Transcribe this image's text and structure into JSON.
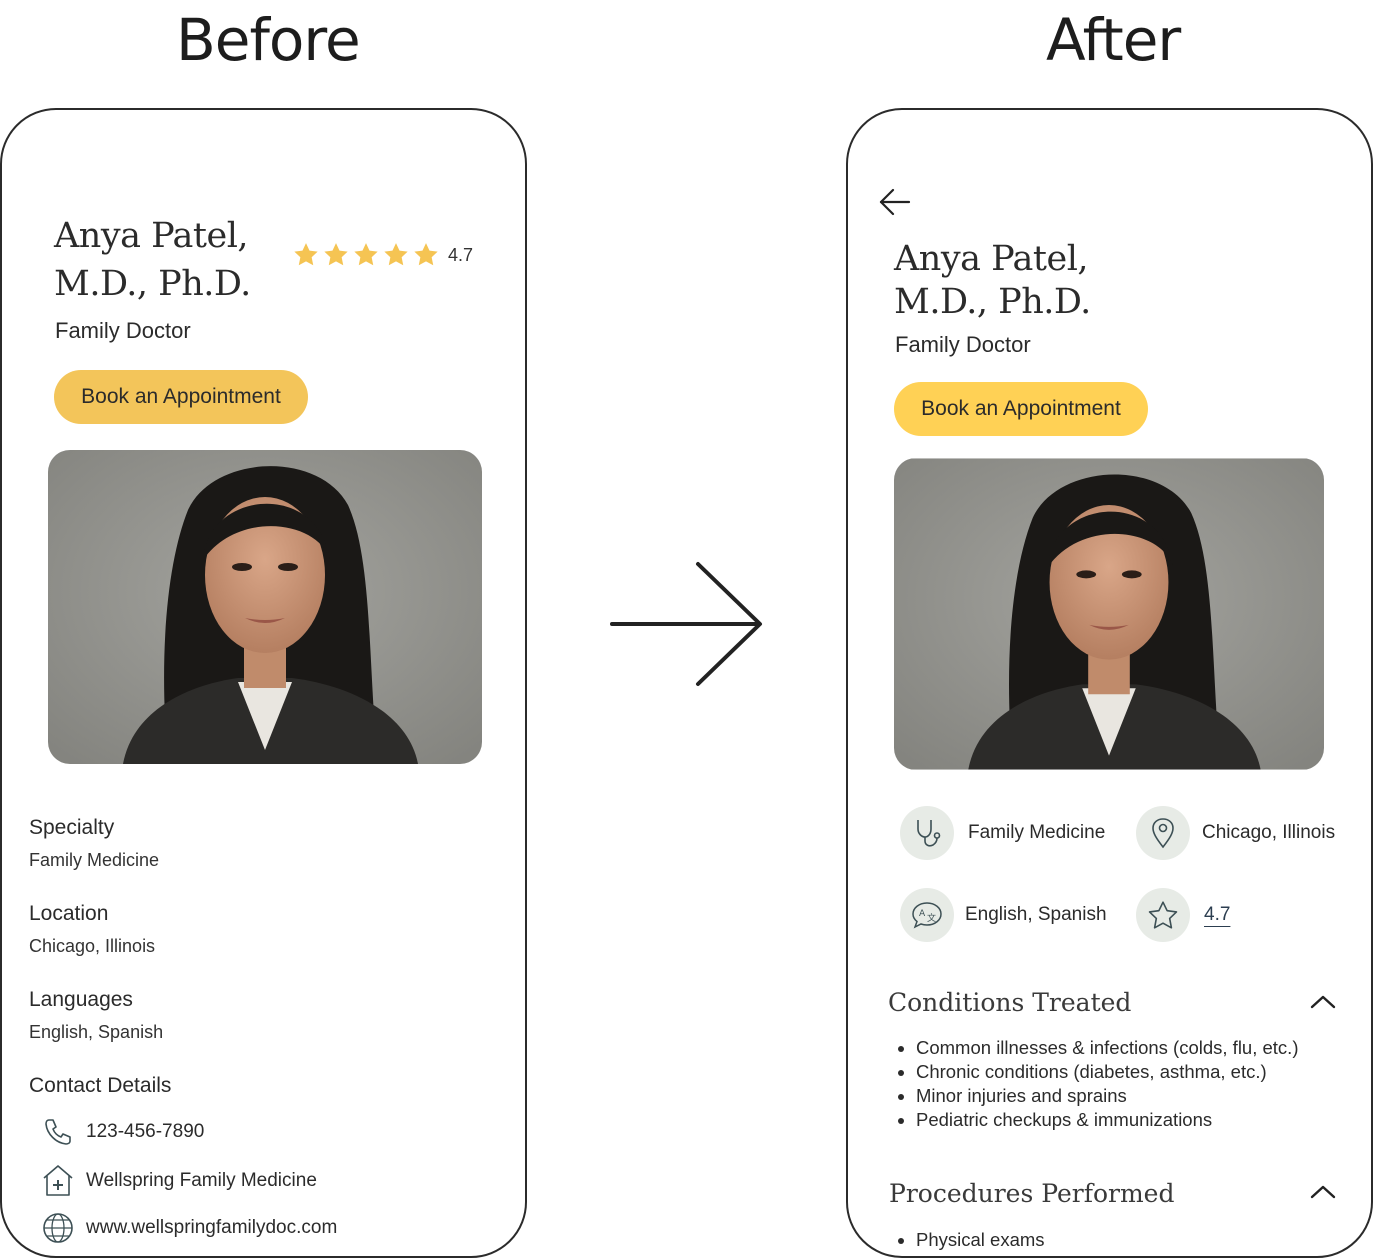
{
  "headings": {
    "before": "Before",
    "after": "After"
  },
  "profile": {
    "name_line1": "Anya Patel,",
    "name_line2": "M.D., Ph.D.",
    "title": "Family Doctor",
    "book_label": "Book an Appointment",
    "rating": "4.7",
    "rating_value": 4.7,
    "stars_total": 5
  },
  "before": {
    "details": [
      {
        "label": "Specialty",
        "value": "Family Medicine"
      },
      {
        "label": "Location",
        "value": "Chicago, Illinois"
      },
      {
        "label": "Languages",
        "value": "English, Spanish"
      }
    ],
    "contact_heading": "Contact Details",
    "contacts": [
      {
        "icon": "phone-icon",
        "text": "123-456-7890"
      },
      {
        "icon": "clinic-icon",
        "text": "Wellspring Family Medicine"
      },
      {
        "icon": "globe-www-icon",
        "text": "www.wellspringfamilydoc.com"
      }
    ]
  },
  "after": {
    "info": [
      {
        "icon": "stethoscope-icon",
        "text": "Family Medicine"
      },
      {
        "icon": "location-pin-icon",
        "text": "Chicago, Illinois"
      },
      {
        "icon": "translate-icon",
        "text": "English, Spanish"
      },
      {
        "icon": "star-outline-icon",
        "text": "4.7"
      }
    ],
    "conditions_title": "Conditions Treated",
    "conditions": [
      "Common illnesses & infections (colds, flu, etc.)",
      "Chronic conditions (diabetes, asthma, etc.)",
      "Minor injuries and sprains",
      "Pediatric checkups & immunizations"
    ],
    "procedures_title": "Procedures Performed",
    "procedures": [
      "Physical exams"
    ]
  },
  "colors": {
    "accent_yellow_before": "#f3c55a",
    "accent_yellow_after": "#ffd155",
    "star_yellow": "#f5c453",
    "icon_circle_bg": "#e7ebe6",
    "icon_stroke": "#3d5055",
    "link": "#2c3e50"
  }
}
